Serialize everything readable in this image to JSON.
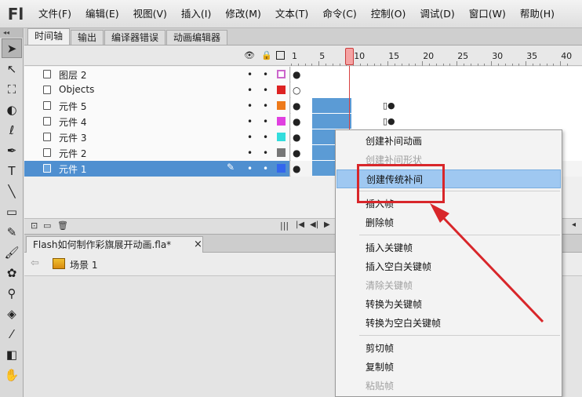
{
  "app": {
    "logo": "Fl",
    "menu": [
      "文件(F)",
      "编辑(E)",
      "视图(V)",
      "插入(I)",
      "修改(M)",
      "文本(T)",
      "命令(C)",
      "控制(O)",
      "调试(D)",
      "窗口(W)",
      "帮助(H)"
    ]
  },
  "toolbar": {
    "collapse": "◂◂",
    "tools": [
      {
        "icon": "selection-arrow-icon",
        "glyph": "➤"
      },
      {
        "icon": "subselection-icon",
        "glyph": "↖"
      },
      {
        "icon": "free-transform-icon",
        "glyph": "⛶"
      },
      {
        "icon": "3d-rotation-icon",
        "glyph": "◐"
      },
      {
        "icon": "lasso-icon",
        "glyph": "ℓ"
      },
      {
        "icon": "pen-icon",
        "glyph": "✒"
      },
      {
        "icon": "text-tool-icon",
        "glyph": "T"
      },
      {
        "icon": "line-tool-icon",
        "glyph": "╲"
      },
      {
        "icon": "rectangle-tool-icon",
        "glyph": "▭"
      },
      {
        "icon": "pencil-tool-icon",
        "glyph": "✎"
      },
      {
        "icon": "brush-tool-icon",
        "glyph": "🖌"
      },
      {
        "icon": "deco-tool-icon",
        "glyph": "✿"
      },
      {
        "icon": "bone-tool-icon",
        "glyph": "⚲"
      },
      {
        "icon": "paint-bucket-icon",
        "glyph": "◈"
      },
      {
        "icon": "eyedropper-icon",
        "glyph": "⁄"
      },
      {
        "icon": "eraser-icon",
        "glyph": "◧"
      },
      {
        "icon": "hand-tool-icon",
        "glyph": "✋"
      }
    ]
  },
  "panel_tabs": [
    "时间轴",
    "输出",
    "编译器错误",
    "动画编辑器"
  ],
  "timeline": {
    "ruler": [
      "1",
      "5",
      "10",
      "15",
      "20",
      "25",
      "30",
      "35",
      "40"
    ],
    "layers": [
      {
        "name": "图层 2",
        "color": "#cc66cc",
        "filled": false
      },
      {
        "name": "Objects",
        "color": "#dd2222",
        "filled": true
      },
      {
        "name": "元件 5",
        "color": "#ee7a1a",
        "filled": true
      },
      {
        "name": "元件 4",
        "color": "#e040e0",
        "filled": true
      },
      {
        "name": "元件 3",
        "color": "#33dddd",
        "filled": true
      },
      {
        "name": "元件 2",
        "color": "#777777",
        "filled": true
      },
      {
        "name": "元件 1",
        "color": "#3366ee",
        "filled": true
      }
    ]
  },
  "document": {
    "tab_title": "Flash如何制作彩旗展开动画.fla*",
    "close": "×",
    "scene": "场景 1"
  },
  "context_menu": {
    "items": [
      {
        "label": "创建补间动画",
        "disabled": false
      },
      {
        "label": "创建补间形状",
        "disabled": true
      },
      {
        "label": "创建传统补间",
        "disabled": false,
        "highlighted": true
      },
      {
        "label": "插入帧",
        "disabled": false
      },
      {
        "label": "删除帧",
        "disabled": false
      },
      {
        "label": "插入关键帧",
        "disabled": false
      },
      {
        "label": "插入空白关键帧",
        "disabled": false
      },
      {
        "label": "清除关键帧",
        "disabled": true
      },
      {
        "label": "转换为关键帧",
        "disabled": false
      },
      {
        "label": "转换为空白关键帧",
        "disabled": false
      },
      {
        "label": "剪切帧",
        "disabled": false
      },
      {
        "label": "复制帧",
        "disabled": false
      },
      {
        "label": "粘贴帧",
        "disabled": true
      }
    ]
  },
  "annotation_color": "#d8262a"
}
